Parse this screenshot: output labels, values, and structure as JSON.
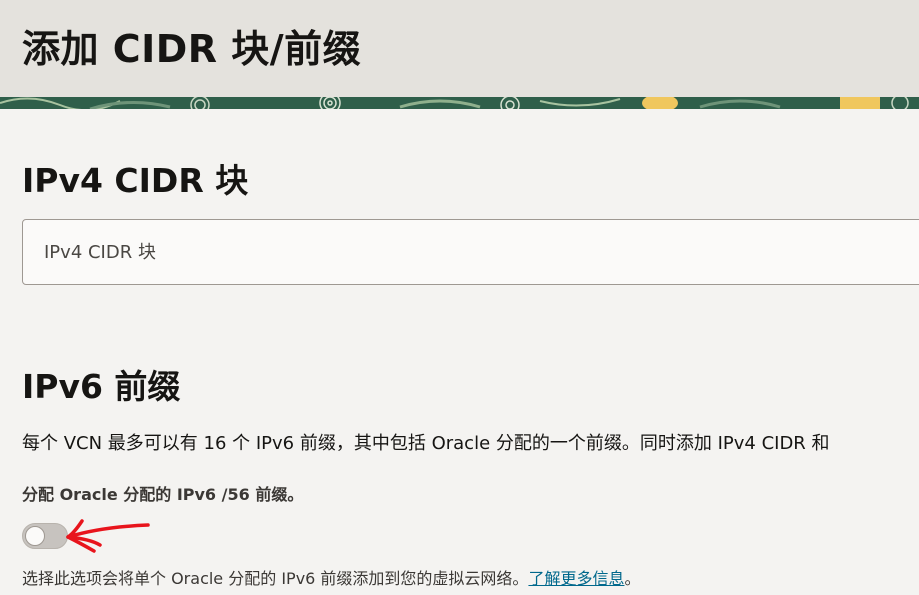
{
  "page": {
    "title": "添加 CIDR 块/前缀"
  },
  "ipv4": {
    "heading": "IPv4 CIDR 块",
    "input_placeholder": "IPv4 CIDR 块",
    "input_value": ""
  },
  "ipv6": {
    "heading": "IPv6 前缀",
    "description": "每个 VCN 最多可以有 16 个 IPv6 前缀，其中包括 Oracle 分配的一个前缀。同时添加 IPv4 CIDR 和",
    "toggle_label": "分配 Oracle 分配的 IPv6 /56 前缀。",
    "toggle_state": "off",
    "helper_text": "选择此选项会将单个 Oracle 分配的 IPv6 前缀添加到您的虚拟云网络。",
    "helper_link": "了解更多信息",
    "helper_suffix": "。"
  },
  "colors": {
    "header_bg": "#e4e2dd",
    "page_bg": "#f4f3f1",
    "link": "#00688c",
    "annotation_red": "#e8141c"
  }
}
